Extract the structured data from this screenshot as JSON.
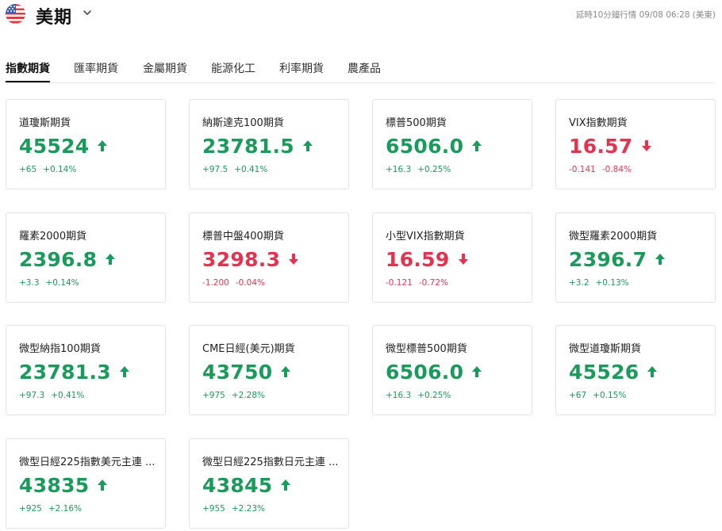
{
  "header": {
    "title": "美期",
    "flag_icon": "us-flag-icon",
    "delay_note": "延時10分鐘行情 09/08 06:28 (美東)"
  },
  "tabs": [
    {
      "label": "指數期貨",
      "active": true
    },
    {
      "label": "匯率期貨",
      "active": false
    },
    {
      "label": "金屬期貨",
      "active": false
    },
    {
      "label": "能源化工",
      "active": false
    },
    {
      "label": "利率期貨",
      "active": false
    },
    {
      "label": "農產品",
      "active": false
    }
  ],
  "colors": {
    "up": "#1a9a5b",
    "down": "#e3344f"
  },
  "cards": [
    {
      "name": "道瓊斯期貨",
      "price": "45524",
      "change": "+65",
      "change_pct": "+0.14%",
      "direction": "up"
    },
    {
      "name": "納斯達克100期貨",
      "price": "23781.5",
      "change": "+97.5",
      "change_pct": "+0.41%",
      "direction": "up"
    },
    {
      "name": "標普500期貨",
      "price": "6506.0",
      "change": "+16.3",
      "change_pct": "+0.25%",
      "direction": "up"
    },
    {
      "name": "VIX指數期貨",
      "price": "16.57",
      "change": "-0.141",
      "change_pct": "-0.84%",
      "direction": "down"
    },
    {
      "name": "羅素2000期貨",
      "price": "2396.8",
      "change": "+3.3",
      "change_pct": "+0.14%",
      "direction": "up"
    },
    {
      "name": "標普中盤400期貨",
      "price": "3298.3",
      "change": "-1.200",
      "change_pct": "-0.04%",
      "direction": "down"
    },
    {
      "name": "小型VIX指數期貨",
      "price": "16.59",
      "change": "-0.121",
      "change_pct": "-0.72%",
      "direction": "down"
    },
    {
      "name": "微型羅素2000期貨",
      "price": "2396.7",
      "change": "+3.2",
      "change_pct": "+0.13%",
      "direction": "up"
    },
    {
      "name": "微型納指100期貨",
      "price": "23781.3",
      "change": "+97.3",
      "change_pct": "+0.41%",
      "direction": "up"
    },
    {
      "name": "CME日經(美元)期貨",
      "price": "43750",
      "change": "+975",
      "change_pct": "+2.28%",
      "direction": "up"
    },
    {
      "name": "微型標普500期貨",
      "price": "6506.0",
      "change": "+16.3",
      "change_pct": "+0.25%",
      "direction": "up"
    },
    {
      "name": "微型道瓊斯期貨",
      "price": "45526",
      "change": "+67",
      "change_pct": "+0.15%",
      "direction": "up"
    },
    {
      "name": "微型日經225指數美元主連 ...",
      "price": "43835",
      "change": "+925",
      "change_pct": "+2.16%",
      "direction": "up"
    },
    {
      "name": "微型日經225指數日元主連 ...",
      "price": "43845",
      "change": "+955",
      "change_pct": "+2.23%",
      "direction": "up"
    }
  ]
}
